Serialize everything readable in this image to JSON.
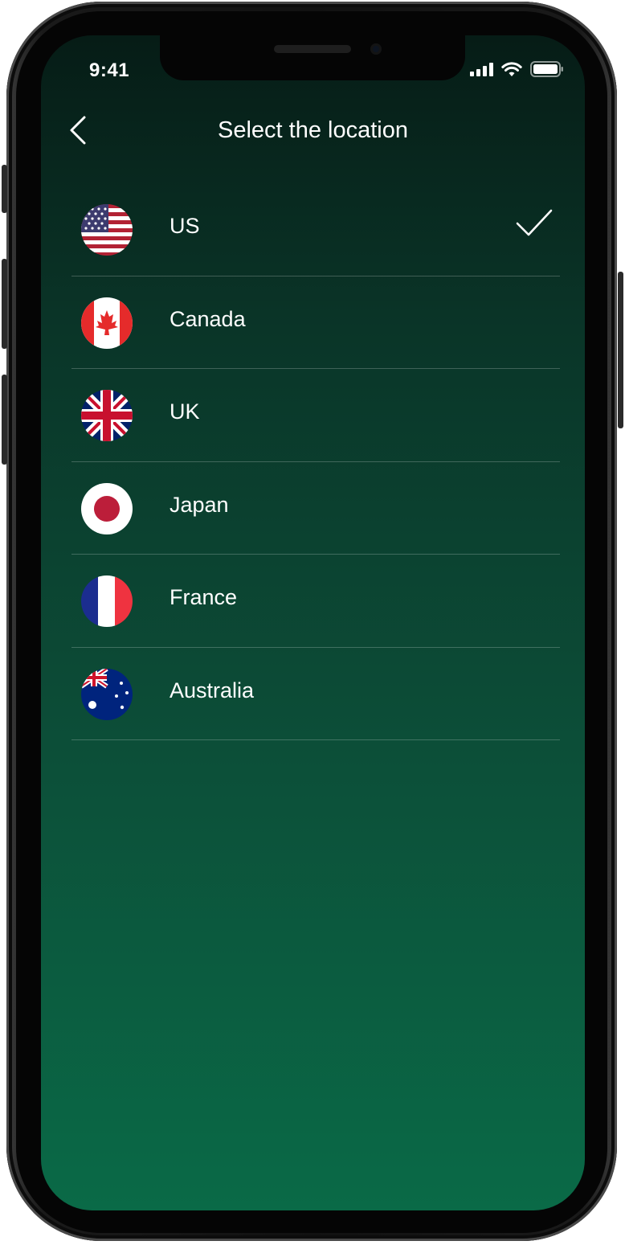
{
  "status_bar": {
    "time": "9:41"
  },
  "header": {
    "back_icon": "chevron-left-icon",
    "title": "Select the location"
  },
  "locations": [
    {
      "label": "US",
      "flag": "us-flag-icon",
      "selected": true
    },
    {
      "label": "Canada",
      "flag": "canada-flag-icon",
      "selected": false
    },
    {
      "label": "UK",
      "flag": "uk-flag-icon",
      "selected": false
    },
    {
      "label": "Japan",
      "flag": "japan-flag-icon",
      "selected": false
    },
    {
      "label": "France",
      "flag": "france-flag-icon",
      "selected": false
    },
    {
      "label": "Australia",
      "flag": "australia-flag-icon",
      "selected": false
    }
  ],
  "selected_indicator": "checkmark-icon",
  "colors": {
    "background_top": "#061c16",
    "background_bottom": "#0a6a47",
    "text": "#ffffff",
    "divider": "rgba(255,255,255,0.22)"
  }
}
